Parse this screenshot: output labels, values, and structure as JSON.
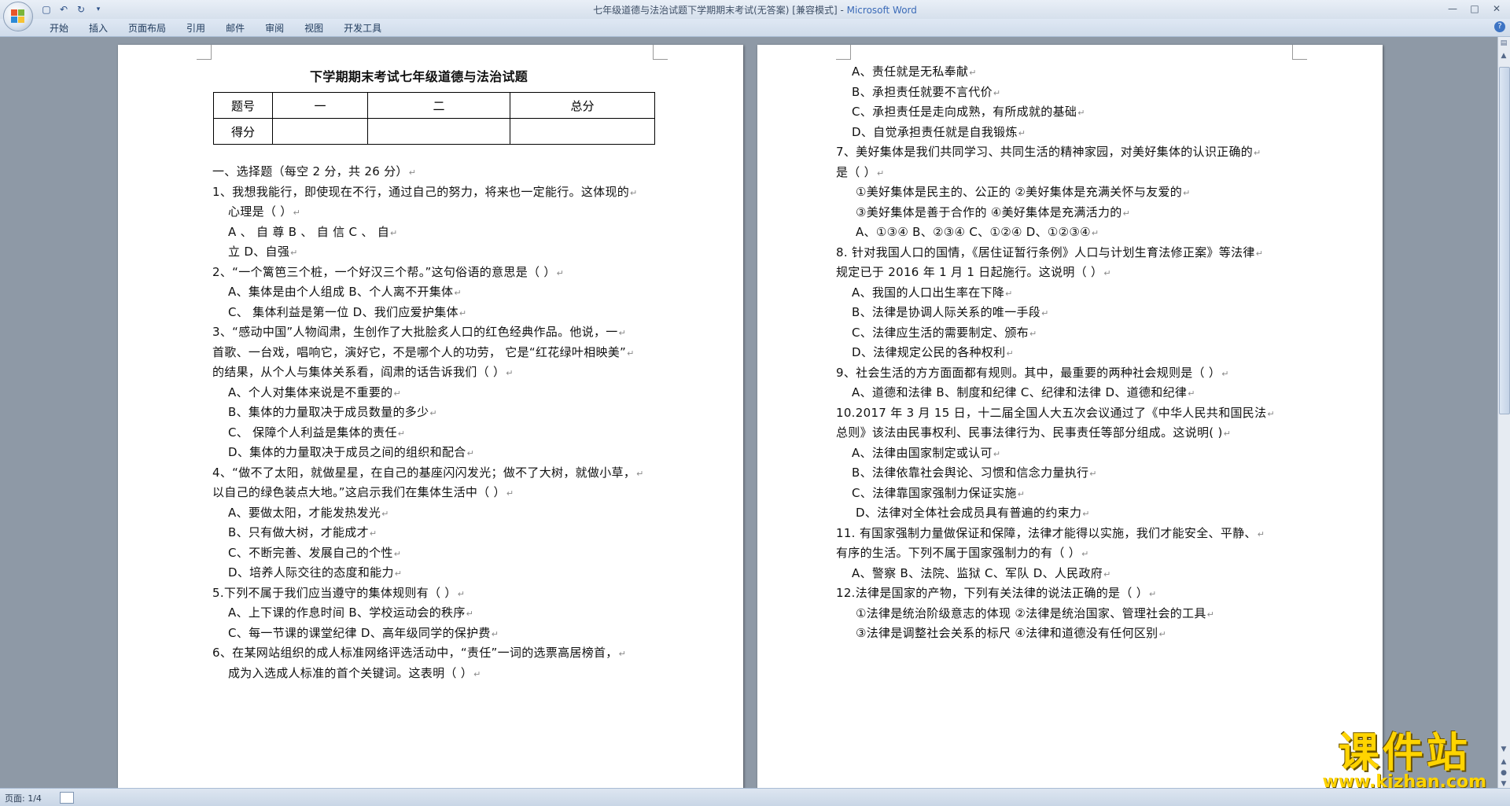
{
  "window": {
    "title": "七年级道德与法治试题下学期期末考试(无答案) [兼容模式] - ",
    "app_name": "Microsoft Word"
  },
  "ribbon": {
    "tabs": [
      "开始",
      "插入",
      "页面布局",
      "引用",
      "邮件",
      "审阅",
      "视图",
      "开发工具"
    ]
  },
  "status": {
    "page": "页面: 1/4"
  },
  "watermark": {
    "main": "课件站",
    "sub": "www.kjzhan.com"
  },
  "page1": {
    "title": "下学期期末考试七年级道德与法治试题",
    "table": {
      "row1": [
        "题号",
        "一",
        "二",
        "总分"
      ],
      "row2": [
        "得分",
        "",
        "",
        ""
      ]
    },
    "lines": [
      "一、选择题（每空 2 分，共 26 分）",
      "1、我想我能行，即使现在不行，通过自己的努力，将来也一定能行。这体现的",
      "心理是（                ）",
      "A 、 自 尊                               B 、 自 信              C 、 自",
      "立                       D、自强",
      "2、“一个篱笆三个桩，一个好汉三个帮。”这句俗语的意思是（          ）",
      "A、集体是由个人组成                       B、个人离不开集体",
      "C、 集体利益是第一位                      D、我们应爱护集体",
      "3、“感动中国”人物阎肃，生创作了大批脍炙人口的红色经典作品。他说，一",
      "首歌、一台戏，唱响它，演好它，不是哪个人的功劳， 它是“红花绿叶相映美”",
      "的结果，从个人与集体关系看，阎肃的话告诉我们（         ）",
      "A、个人对集体来说是不重要的",
      "B、集体的力量取决于成员数量的多少",
      "C、 保障个人利益是集体的责任",
      "D、集体的力量取决于成员之间的组织和配合",
      "4、“做不了太阳，就做星星，在自己的基座闪闪发光；做不了大树，就做小草，",
      "以自己的绿色装点大地。”这启示我们在集体生活中（         ）",
      "A、要做太阳，才能发热发光",
      "B、只有做大树，才能成才",
      "C、不断完善、发展自己的个性",
      "D、培养人际交往的态度和能力",
      "5.下列不属于我们应当遵守的集体规则有（        ）",
      "A、上下课的作息时间                         B、学校运动会的秩序",
      "C、每一节课的课堂纪律                       D、高年级同学的保护费",
      "6、在某网站组织的成人标准网络评选活动中，“责任”一词的选票高居榜首，",
      "成为入选成人标准的首个关键词。这表明（          ）"
    ]
  },
  "page2": {
    "lines": [
      "A、责任就是无私奉献",
      "B、承担责任就要不言代价",
      "C、承担责任是走向成熟，有所成就的基础",
      "D、自觉承担责任就是自我锻炼",
      "7、美好集体是我们共同学习、共同生活的精神家园，对美好集体的认识正确的",
      "是（    ）",
      "①美好集体是民主的、公正的              ②美好集体是充满关怀与友爱的",
      "③美好集体是善于合作的                  ④美好集体是充满活力的",
      "A、①③④           B、②③④                C、①②④          D、①②③④",
      "8. 针对我国人口的国情，《居住证暂行条例》人口与计划生育法修正案》等法律",
      "规定已于 2016 年 1 月 1 日起施行。这说明（          ）",
      "A、我国的人口出生率在下降",
      "B、法律是协调人际关系的唯一手段",
      "C、法律应生活的需要制定、颁布",
      "D、法律规定公民的各种权利",
      "9、社会生活的方方面面都有规则。其中，最重要的两种社会规则是（          ）",
      "A、道德和法律          B、制度和纪律          C、纪律和法律          D、道德和纪律",
      "10.2017 年 3 月 15 日，十二届全国人大五次会议通过了《中华人民共和国民法",
      "总则》该法由民事权利、民事法律行为、民事责任等部分组成。这说明(          )",
      "A、法律由国家制定或认可",
      "B、法律依靠社会舆论、习惯和信念力量执行",
      "C、法律靠国家强制力保证实施",
      "D、法律对全体社会成员具有普遍的约束力",
      "11. 有国家强制力量做保证和保障，法律才能得以实施，我们才能安全、平静、",
      "有序的生活。下列不属于国家强制力的有（            ）",
      "A、警察                B、法院、监狱            C、军队            D、人民政府",
      "12.法律是国家的产物，下列有关法律的说法正确的是（          ）",
      "①法律是统治阶级意志的体现              ②法律是统治国家、管理社会的工具",
      "③法律是调整社会关系的标尺              ④法律和道德没有任何区别"
    ]
  }
}
